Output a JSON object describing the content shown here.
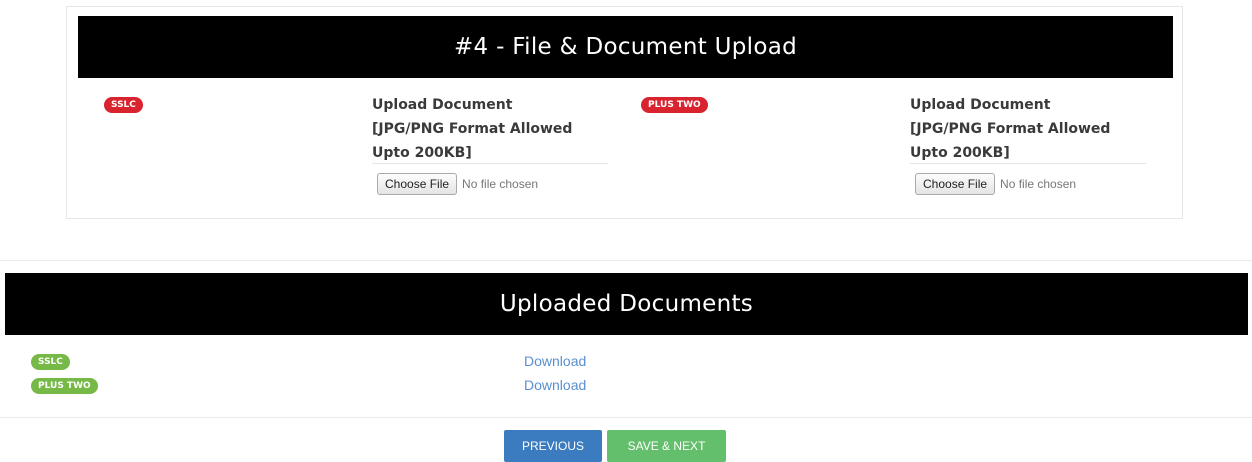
{
  "upload_section": {
    "title": "#4 - File & Document Upload",
    "documents": [
      {
        "badge": "SSLC",
        "label_line1": "Upload Document",
        "label_line2": "[JPG/PNG Format Allowed",
        "label_line3": "Upto 200KB]",
        "button_label": "Choose File",
        "status": "No file chosen"
      },
      {
        "badge": "PLUS TWO",
        "label_line1": "Upload Document",
        "label_line2": "[JPG/PNG Format Allowed",
        "label_line3": "Upto 200KB]",
        "button_label": "Choose File",
        "status": "No file chosen"
      }
    ]
  },
  "uploaded_section": {
    "title": "Uploaded Documents",
    "items": [
      {
        "badge": "SSLC",
        "link": "Download"
      },
      {
        "badge": "PLUS TWO",
        "link": "Download"
      }
    ]
  },
  "actions": {
    "previous_label": "PREVIOUS",
    "save_next_label": "SAVE & NEXT"
  },
  "colors": {
    "banner": "#000000",
    "badge_red": "#d9232e",
    "badge_green": "#76b947",
    "link": "#5a8fcf",
    "previous_button": "#3b7bc0",
    "save_button": "#63bf6b"
  }
}
